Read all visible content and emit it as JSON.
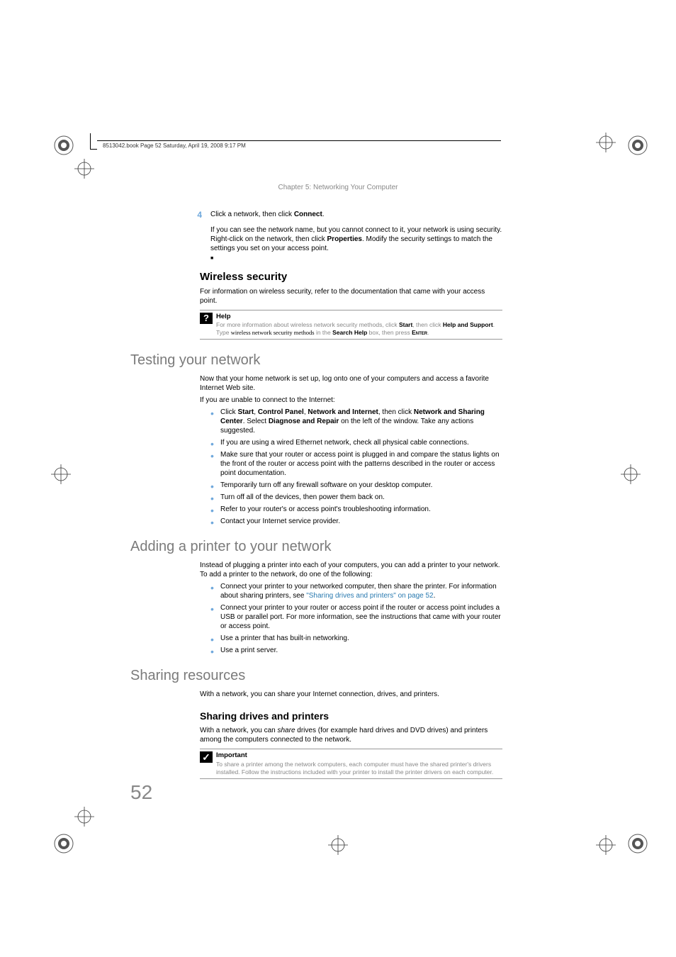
{
  "header": {
    "rule_text": "8513042.book  Page 52  Saturday, April 19, 2008  9:17 PM",
    "chapter": "Chapter 5: Networking Your Computer"
  },
  "step4": {
    "num": "4",
    "line1_a": "Click a network, then click ",
    "line1_b": "Connect",
    "line1_c": ".",
    "p2_a": "If you can see the network name, but you cannot connect to it, your network is using security. Right-click on the network, then click ",
    "p2_b": "Properties",
    "p2_c": ". Modify the security settings to match the settings you set on your access point."
  },
  "wireless": {
    "title": "Wireless security",
    "p1": "For information on wireless security, refer to the documentation that came with your access point."
  },
  "help_box": {
    "title": "Help",
    "t1": "For more information about wireless network security methods, click ",
    "b1": "Start",
    "t2": ", then click ",
    "b2": "Help and Support",
    "t3": ". Type ",
    "serif": "wireless network security methods",
    "t4": " in the ",
    "b3": "Search Help",
    "t5": " box, then press ",
    "sc1": "Enter",
    "t6": "."
  },
  "testing": {
    "title": "Testing your network",
    "p1": "Now that your home network is set up, log onto one of your computers and access a favorite Internet Web site.",
    "p2": "If you are unable to connect to the Internet:",
    "b1_a": "Click ",
    "b1_b": "Start",
    "b1_c": ", ",
    "b1_d": "Control Panel",
    "b1_e": ", ",
    "b1_f": "Network and Internet",
    "b1_g": ", then click ",
    "b1_h": "Network and Sharing Center",
    "b1_i": ". Select ",
    "b1_j": "Diagnose and Repair",
    "b1_k": " on the left of the window. Take any actions suggested.",
    "b2": "If you are using a wired Ethernet network, check all physical cable connections.",
    "b3": "Make sure that your router or access point is plugged in and compare the status lights on the front of the router or access point with the patterns described in the router or access point documentation.",
    "b4": "Temporarily turn off any firewall software on your desktop computer.",
    "b5": "Turn off all of the devices, then power them back on.",
    "b6": "Refer to your router's or access point's troubleshooting information.",
    "b7": "Contact your Internet service provider."
  },
  "printer": {
    "title": "Adding a printer to your network",
    "p1": "Instead of plugging a printer into each of your computers, you can add a printer to your network. To add a printer to the network, do one of the following:",
    "b1_a": "Connect your printer to your networked computer, then share the printer. For information about sharing printers, see ",
    "b1_link": "\"Sharing drives and printers\" on page 52",
    "b1_b": ".",
    "b2": "Connect your printer to your router or access point if the router or access point includes a USB or parallel port. For more information, see the instructions that came with your router or access point.",
    "b3": "Use a printer that has built-in networking.",
    "b4": "Use a print server."
  },
  "sharing": {
    "title": "Sharing resources",
    "p1": "With a network, you can share your Internet connection, drives, and printers.",
    "sub": "Sharing drives and printers",
    "p2_a": "With a network, you can ",
    "p2_i": "share",
    "p2_b": " drives (for example hard drives and DVD drives) and printers among the computers connected to the network."
  },
  "important_box": {
    "title": "Important",
    "text": "To share a printer among the network computers, each computer must have the shared printer's drivers installed. Follow the instructions included with your printer to install the printer drivers on each computer."
  },
  "page_num": "52"
}
